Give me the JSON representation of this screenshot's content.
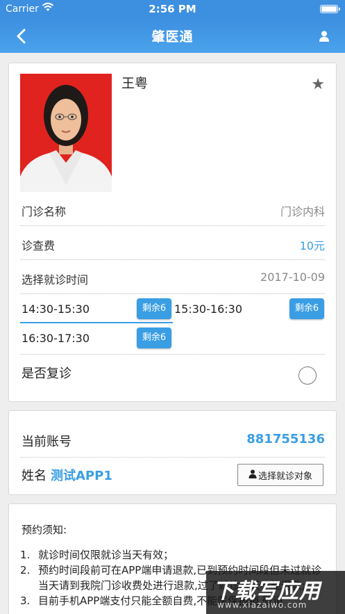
{
  "status_bar": {
    "carrier": "Carrier",
    "time": "2:56 PM"
  },
  "nav": {
    "title": "肇医通"
  },
  "doctor": {
    "name": "王粤",
    "photo_bg_color": "#e0231e",
    "rows": [
      {
        "label": "门诊名称",
        "value": "门诊内科"
      },
      {
        "label": "诊查费",
        "value": "10元"
      },
      {
        "label": "选择就诊时间",
        "value": "2017-10-09"
      }
    ],
    "slots": [
      {
        "time": "14:30-15:30",
        "remain": "剩余6",
        "selected": true
      },
      {
        "time": "15:30-16:30",
        "remain": "剩余6",
        "selected": false
      },
      {
        "time": "16:30-17:30",
        "remain": "剩余6",
        "selected": false
      }
    ],
    "revisit_label": "是否复诊"
  },
  "account": {
    "account_label": "当前账号",
    "account_value": "881755136",
    "name_label": "姓名",
    "name_value": "测试APP1",
    "select_button": "选择就诊对象"
  },
  "notice": {
    "title": "预约须知:",
    "items": [
      {
        "num": "1.",
        "text": "就诊时间仅限就诊当天有效；"
      },
      {
        "num": "2.",
        "text": "预约时间段前可在APP端申请退款,已到预约时间段但未过就诊当天请到我院门诊收费处进行退款,过了就诊当天不能退款;"
      },
      {
        "num": "3.",
        "text": "目前手机APP端支付只能全额自费,不能医保报销,敬请"
      }
    ]
  },
  "watermark": {
    "big": "下载写应用",
    "small": "www.xiazaiwo.com"
  },
  "colors": {
    "accent": "#3a9ee4",
    "nav": "#3d8fe0"
  }
}
